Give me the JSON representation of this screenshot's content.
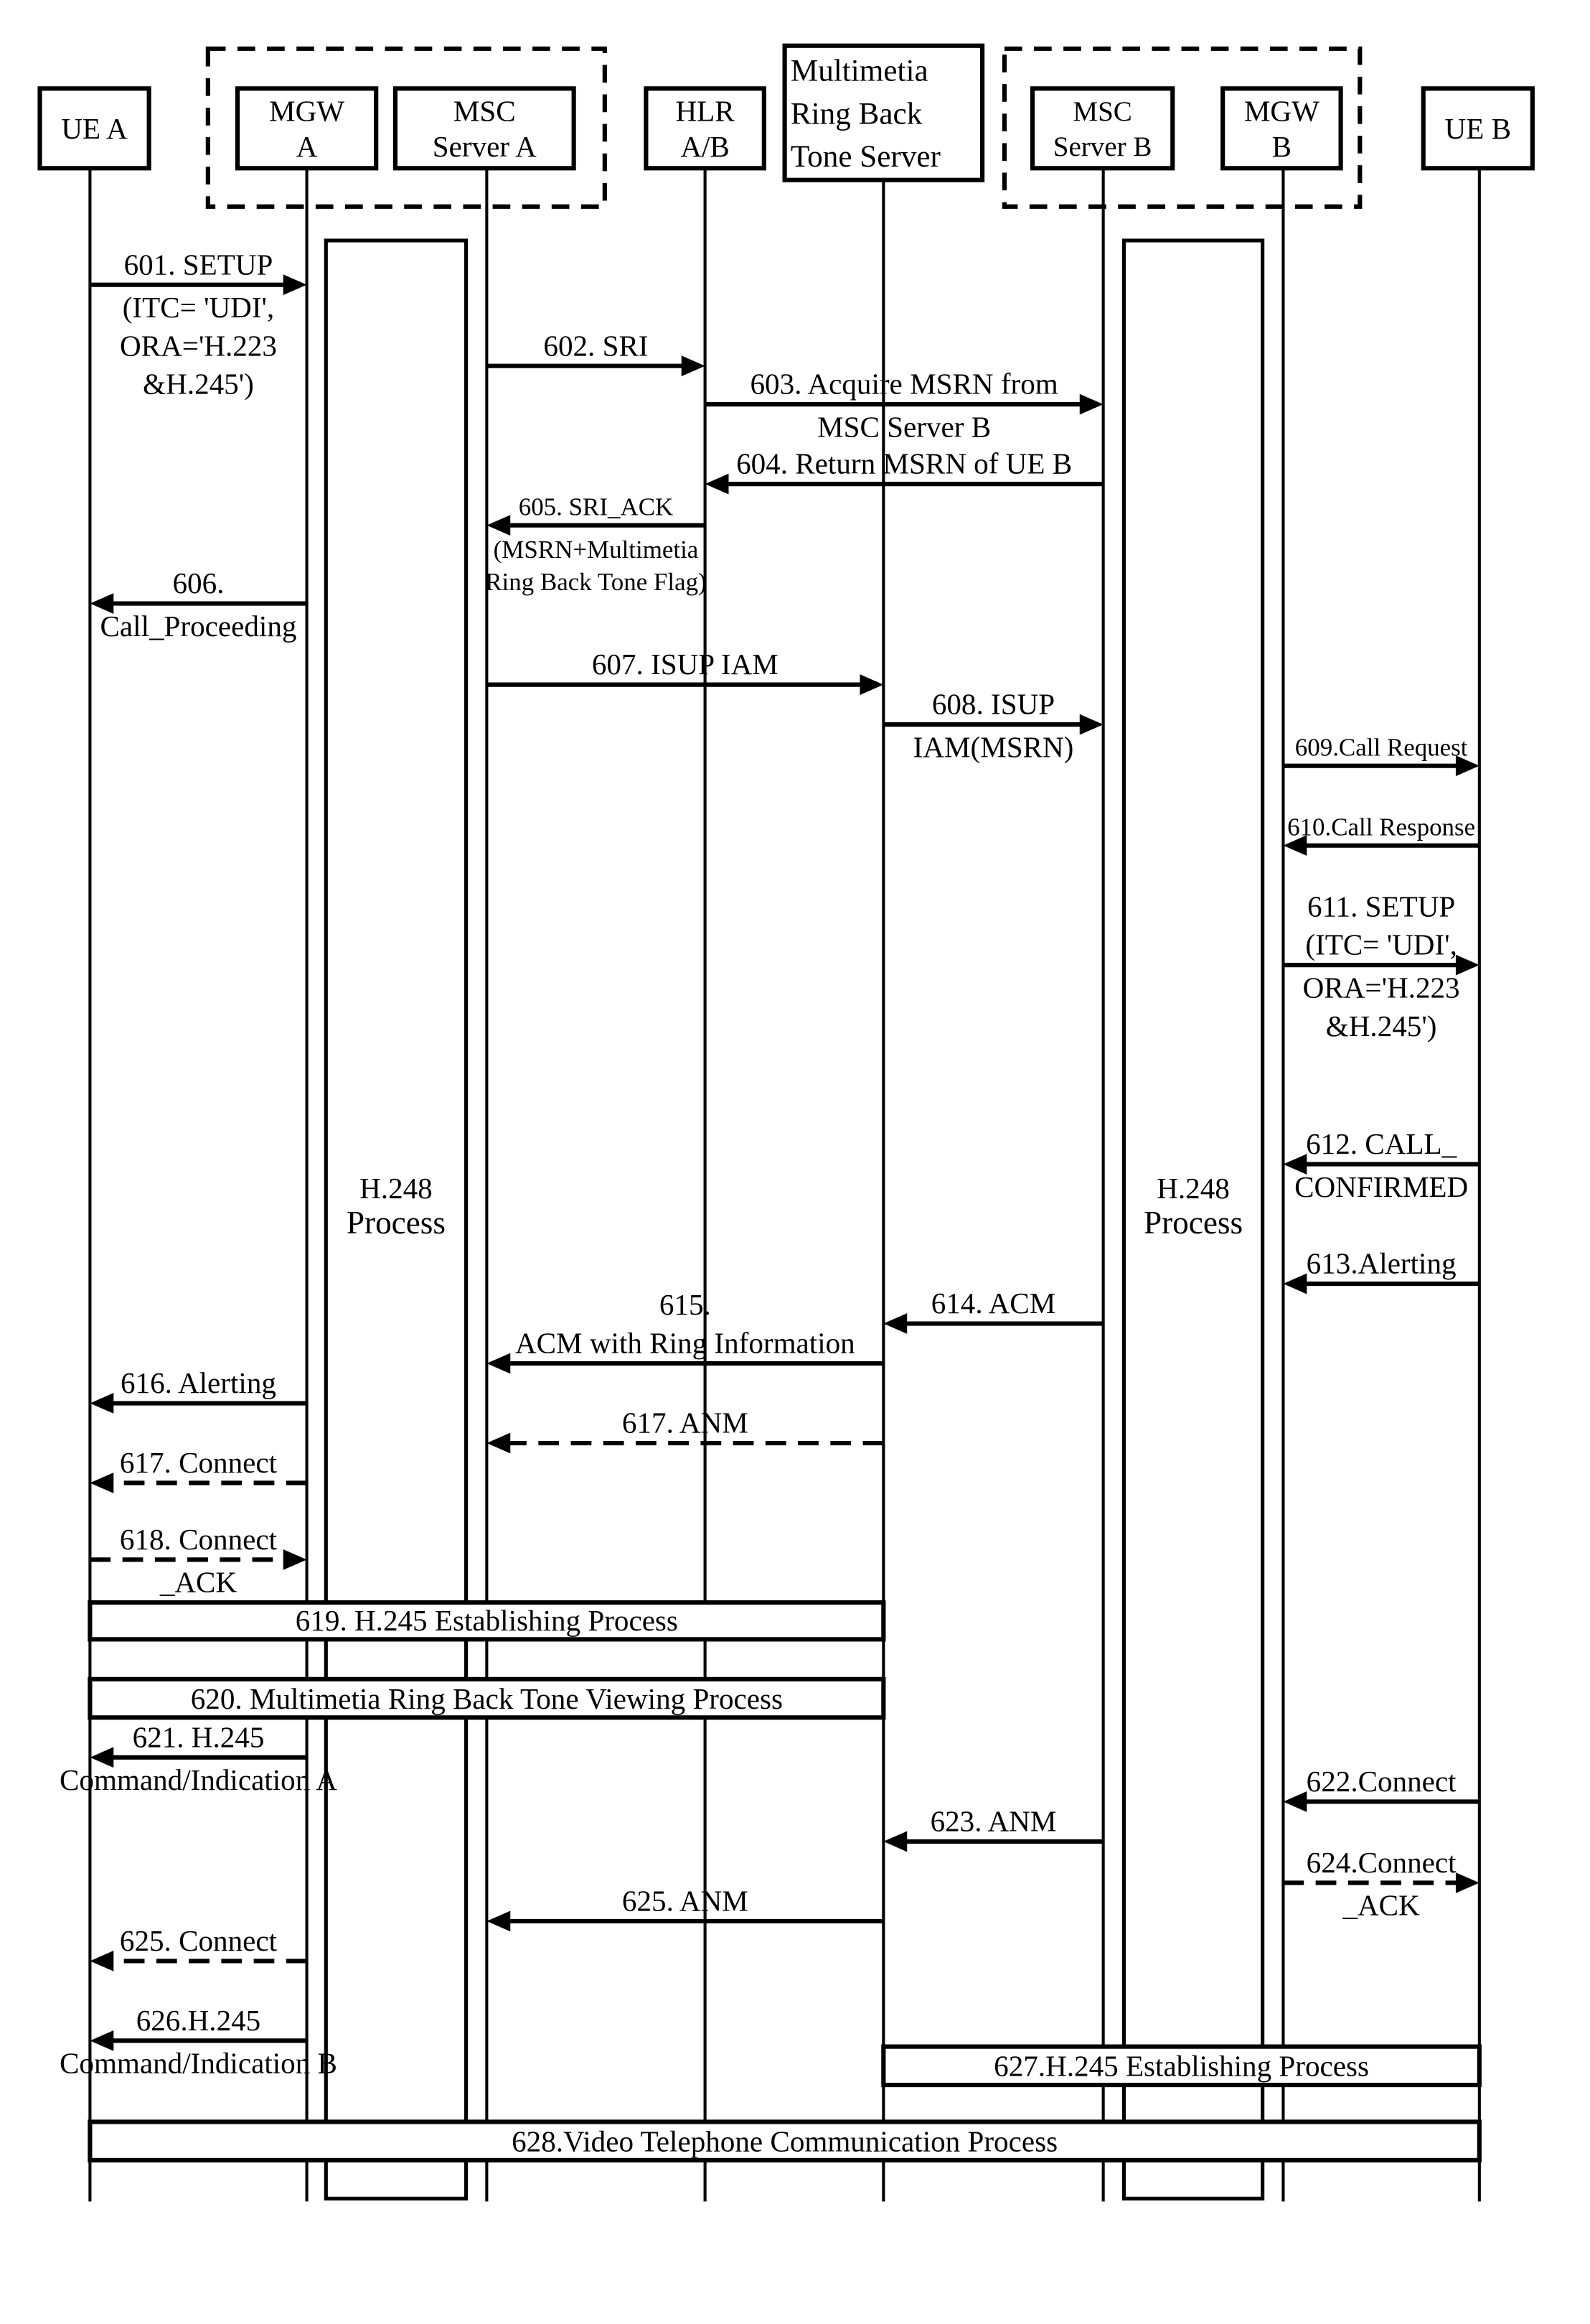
{
  "participants": [
    {
      "id": "ueA",
      "lines": [
        "UE A"
      ]
    },
    {
      "id": "mgwA",
      "lines": [
        "MGW",
        "A"
      ]
    },
    {
      "id": "mscA",
      "lines": [
        "MSC",
        "Server A"
      ]
    },
    {
      "id": "hlr",
      "lines": [
        "HLR",
        "A/B"
      ]
    },
    {
      "id": "mrbt",
      "lines": [
        "Multimetia",
        "Ring Back",
        "Tone Server"
      ]
    },
    {
      "id": "mscB",
      "lines": [
        "MSC",
        "Server B"
      ]
    },
    {
      "id": "mgwB",
      "lines": [
        "MGW",
        "B"
      ]
    },
    {
      "id": "ueB",
      "lines": [
        "UE B"
      ]
    }
  ],
  "groups": [
    {
      "name": "network-a",
      "members": [
        "mgwA",
        "mscA"
      ]
    },
    {
      "name": "network-b",
      "members": [
        "mscB",
        "mgwB"
      ]
    }
  ],
  "processes": [
    {
      "name": "h248-process-a",
      "lines": [
        "H.248",
        "Process"
      ]
    },
    {
      "name": "h248-process-b",
      "lines": [
        "H.248",
        "Process"
      ]
    }
  ],
  "messages": [
    {
      "id": "601",
      "from": "ueA",
      "to": "mgwA",
      "style": "solid",
      "above": [
        "601. SETUP"
      ],
      "below": [
        "(ITC= 'UDI',",
        "ORA='H.223",
        "&H.245')"
      ]
    },
    {
      "id": "602",
      "from": "mscA",
      "to": "hlr",
      "style": "solid",
      "above": [
        "602. SRI"
      ],
      "below": []
    },
    {
      "id": "603",
      "from": "hlr",
      "to": "mscB",
      "style": "solid",
      "above": [
        "603. Acquire MSRN from"
      ],
      "below": [
        "MSC Server B"
      ]
    },
    {
      "id": "604",
      "from": "mscB",
      "to": "hlr",
      "style": "solid",
      "above": [
        "604. Return MSRN of UE B"
      ],
      "below": []
    },
    {
      "id": "605",
      "from": "hlr",
      "to": "mscA",
      "style": "solid",
      "above": [
        "605. SRI_ACK"
      ],
      "below": [
        "(MSRN+Multimetia",
        "Ring Back Tone Flag)"
      ]
    },
    {
      "id": "606",
      "from": "mgwA",
      "to": "ueA",
      "style": "solid",
      "above": [
        "606."
      ],
      "below": [
        "Call_Proceeding"
      ]
    },
    {
      "id": "607",
      "from": "mscA",
      "to": "mrbt",
      "style": "solid",
      "above": [
        "607. ISUP IAM"
      ],
      "below": []
    },
    {
      "id": "608",
      "from": "mrbt",
      "to": "mscB",
      "style": "solid",
      "above": [
        "608. ISUP"
      ],
      "below": [
        "IAM(MSRN)"
      ]
    },
    {
      "id": "609",
      "from": "mgwB",
      "to": "ueB",
      "style": "solid",
      "above": [
        "609.Call Request"
      ],
      "below": []
    },
    {
      "id": "610",
      "from": "ueB",
      "to": "mgwB",
      "style": "solid",
      "above": [
        "610.Call Response"
      ],
      "below": []
    },
    {
      "id": "611",
      "from": "mgwB",
      "to": "ueB",
      "style": "solid",
      "above": [
        "611. SETUP",
        "(ITC= 'UDI',"
      ],
      "below": [
        "ORA='H.223",
        "&H.245')"
      ]
    },
    {
      "id": "612",
      "from": "ueB",
      "to": "mgwB",
      "style": "solid",
      "above": [
        "612. CALL_"
      ],
      "below": [
        "CONFIRMED"
      ]
    },
    {
      "id": "613",
      "from": "ueB",
      "to": "mgwB",
      "style": "solid",
      "above": [
        "613.Alerting"
      ],
      "below": []
    },
    {
      "id": "614",
      "from": "mscB",
      "to": "mrbt",
      "style": "solid",
      "above": [
        "614. ACM"
      ],
      "below": []
    },
    {
      "id": "615",
      "from": "mrbt",
      "to": "mscA",
      "style": "solid",
      "above": [
        "615.",
        "ACM with Ring Information"
      ],
      "below": []
    },
    {
      "id": "616",
      "from": "mgwA",
      "to": "ueA",
      "style": "solid",
      "above": [
        "616. Alerting"
      ],
      "below": []
    },
    {
      "id": "617a",
      "from": "mrbt",
      "to": "mscA",
      "style": "dashed",
      "above": [
        "617. ANM"
      ],
      "below": []
    },
    {
      "id": "617b",
      "from": "mgwA",
      "to": "ueA",
      "style": "dashed",
      "above": [
        "617. Connect"
      ],
      "below": []
    },
    {
      "id": "618",
      "from": "ueA",
      "to": "mgwA",
      "style": "dashed",
      "above": [
        "618. Connect"
      ],
      "below": [
        "_ACK"
      ]
    },
    {
      "id": "621",
      "from": "mgwA",
      "to": "ueA",
      "style": "solid",
      "above": [
        "621.  H.245"
      ],
      "below": [
        "Command/Indication A"
      ]
    },
    {
      "id": "622",
      "from": "ueB",
      "to": "mgwB",
      "style": "solid",
      "above": [
        "622.Connect"
      ],
      "below": []
    },
    {
      "id": "623",
      "from": "mscB",
      "to": "mrbt",
      "style": "solid",
      "above": [
        "623. ANM"
      ],
      "below": []
    },
    {
      "id": "624",
      "from": "mgwB",
      "to": "ueB",
      "style": "dashed",
      "above": [
        "624.Connect"
      ],
      "below": [
        "_ACK"
      ]
    },
    {
      "id": "625a",
      "from": "mrbt",
      "to": "mscA",
      "style": "solid",
      "above": [
        "625. ANM"
      ],
      "below": []
    },
    {
      "id": "625b",
      "from": "mgwA",
      "to": "ueA",
      "style": "dashed",
      "above": [
        "625. Connect"
      ],
      "below": []
    },
    {
      "id": "626",
      "from": "mgwA",
      "to": "ueA",
      "style": "solid",
      "above": [
        "626.H.245"
      ],
      "below": [
        "Command/Indication B"
      ]
    }
  ],
  "bands": [
    {
      "id": "619",
      "from": "ueA",
      "to": "mrbt",
      "label": "619. H.245 Establishing Process"
    },
    {
      "id": "620",
      "from": "ueA",
      "to": "mrbt",
      "label": "620.  Multimetia Ring Back Tone Viewing Process"
    },
    {
      "id": "627",
      "from": "mrbt",
      "to": "ueB",
      "label": "627.H.245 Establishing Process"
    },
    {
      "id": "628",
      "from": "ueA",
      "to": "ueB",
      "label": "628.Video Telephone Communication Process"
    }
  ]
}
